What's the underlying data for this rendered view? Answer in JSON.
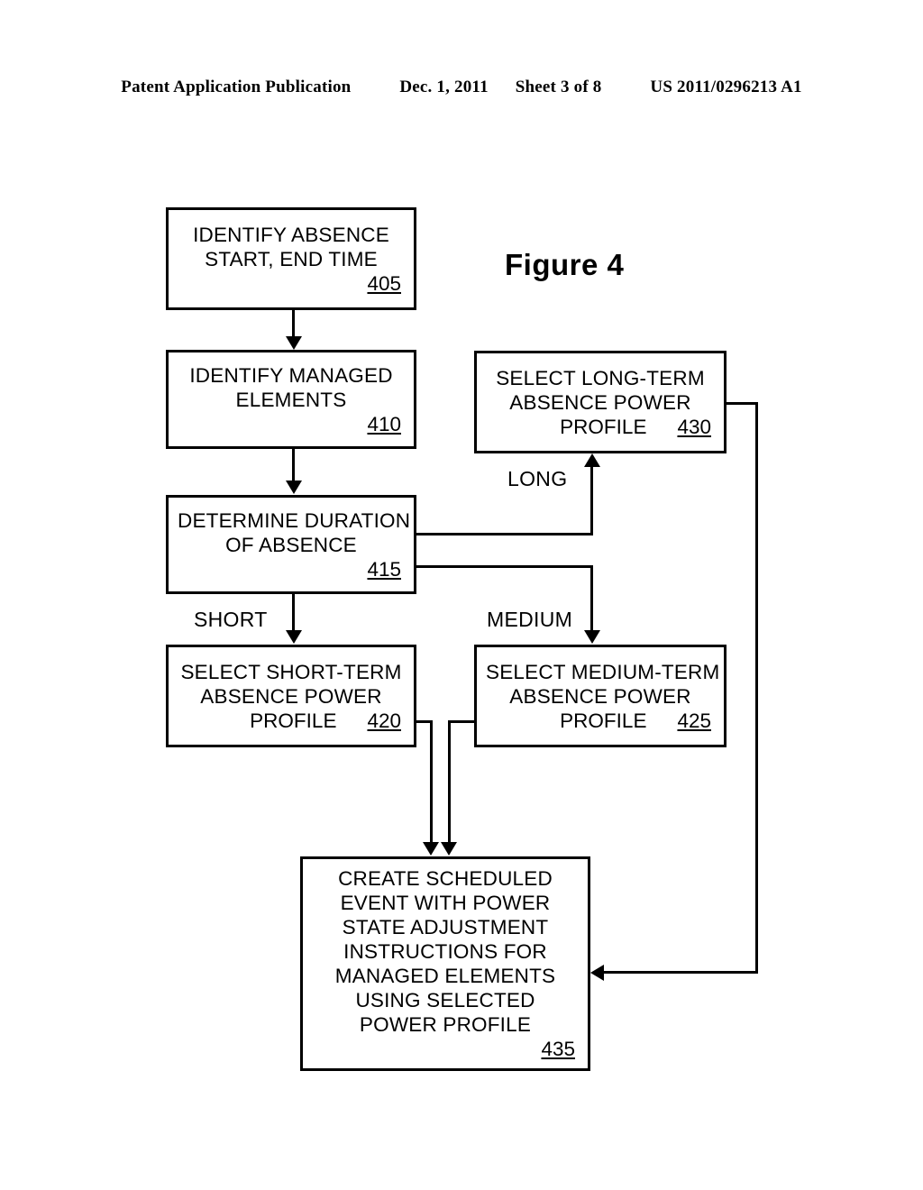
{
  "header": {
    "publication": "Patent Application Publication",
    "date": "Dec. 1, 2011",
    "sheet": "Sheet 3 of 8",
    "patent_number": "US 2011/0296213 A1"
  },
  "figure": {
    "title": "Figure 4"
  },
  "boxes": {
    "b405": {
      "line1": "IDENTIFY ABSENCE",
      "line2": "START, END TIME",
      "ref": "405"
    },
    "b410": {
      "line1": "IDENTIFY MANAGED",
      "line2": "ELEMENTS",
      "ref": "410"
    },
    "b415": {
      "line1": "DETERMINE DURATION",
      "line2": "OF ABSENCE",
      "ref": "415"
    },
    "b420": {
      "line1": "SELECT SHORT-TERM",
      "line2": "ABSENCE POWER",
      "line3": "PROFILE",
      "ref": "420"
    },
    "b425": {
      "line1": "SELECT MEDIUM-TERM",
      "line2": "ABSENCE POWER",
      "line3": "PROFILE",
      "ref": "425"
    },
    "b430": {
      "line1": "SELECT LONG-TERM",
      "line2": "ABSENCE POWER",
      "line3": "PROFILE",
      "ref": "430"
    },
    "b435": {
      "line1": "CREATE SCHEDULED",
      "line2": "EVENT WITH POWER",
      "line3": "STATE ADJUSTMENT",
      "line4": "INSTRUCTIONS FOR",
      "line5": "MANAGED ELEMENTS",
      "line6": "USING SELECTED",
      "line7": "POWER PROFILE",
      "ref": "435"
    }
  },
  "branches": {
    "long": "LONG",
    "short": "SHORT",
    "medium": "MEDIUM"
  },
  "colors": {
    "ink": "#000000",
    "paper": "#ffffff"
  }
}
